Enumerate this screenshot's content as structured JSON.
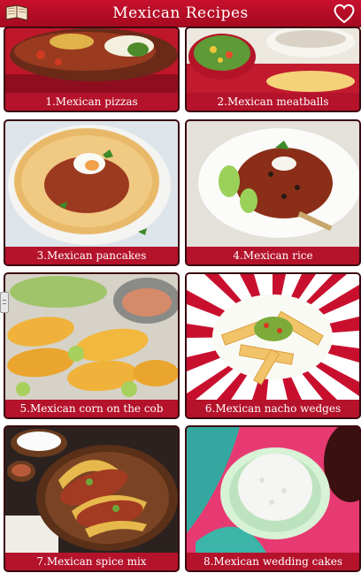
{
  "header": {
    "title": "Mexican Recipes",
    "left_icon": "book-icon",
    "right_icon": "heart-icon",
    "accent": "#c8102e"
  },
  "recipes": [
    {
      "label": "1.Mexican pizzas"
    },
    {
      "label": "2.Mexican meatballs"
    },
    {
      "label": "3.Mexican pancakes"
    },
    {
      "label": "4.Mexican rice"
    },
    {
      "label": "5.Mexican corn on the cob"
    },
    {
      "label": "6.Mexican nacho wedges"
    },
    {
      "label": "7.Mexican spice mix"
    },
    {
      "label": "8.Mexican wedding cakes"
    }
  ]
}
